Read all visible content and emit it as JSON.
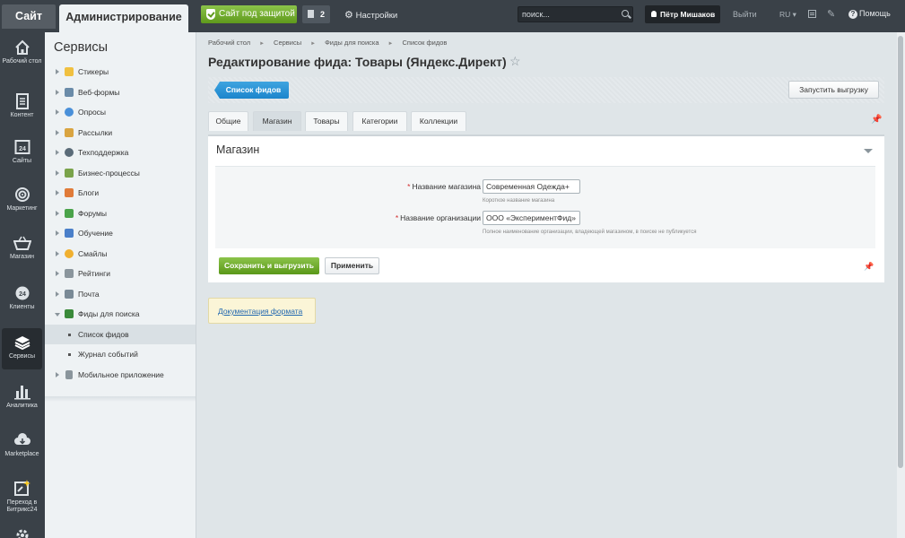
{
  "topbar": {
    "site_tab": "Сайт",
    "admin_tab": "Администрирование",
    "protect_button": "Сайт под защитой",
    "notifications_count": "2",
    "settings_label": "Настройки",
    "search_placeholder": "поиск...",
    "user_name": "Пётр Мишаков",
    "logout_label": "Выйти",
    "language": "RU",
    "help_label": "Помощь"
  },
  "leftnav": {
    "items": [
      {
        "label": "Рабочий стол",
        "icon": "home-icon"
      },
      {
        "label": "Контент",
        "icon": "document-icon"
      },
      {
        "label": "Сайты",
        "icon": "calendar-24-icon"
      },
      {
        "label": "Маркетинг",
        "icon": "target-icon"
      },
      {
        "label": "Магазин",
        "icon": "basket-icon"
      },
      {
        "label": "Клиенты",
        "icon": "clients-24-icon"
      },
      {
        "label": "Сервисы",
        "icon": "layers-icon"
      },
      {
        "label": "Аналитика",
        "icon": "bar-chart-icon"
      },
      {
        "label": "Marketplace",
        "icon": "cloud-download-icon"
      },
      {
        "label": "Переход в Битрикс24",
        "icon": "bitrix24-icon"
      }
    ]
  },
  "services": {
    "title": "Сервисы",
    "items": [
      {
        "label": "Стикеры",
        "color": "#f0c040"
      },
      {
        "label": "Веб-формы",
        "color": "#6a8ba8"
      },
      {
        "label": "Опросы",
        "color": "#4a90d9"
      },
      {
        "label": "Рассылки",
        "color": "#d9a441"
      },
      {
        "label": "Техподдержка",
        "color": "#5a6b78"
      },
      {
        "label": "Бизнес-процессы",
        "color": "#7aa34a"
      },
      {
        "label": "Блоги",
        "color": "#e07b39"
      },
      {
        "label": "Форумы",
        "color": "#4aa34a"
      },
      {
        "label": "Обучение",
        "color": "#4a7fc9"
      },
      {
        "label": "Смайлы",
        "color": "#f0b030"
      },
      {
        "label": "Рейтинги",
        "color": "#8a959c"
      },
      {
        "label": "Почта",
        "color": "#7a8a96"
      },
      {
        "label": "Фиды для поиска",
        "color": "#3a8a3a"
      },
      {
        "label": "Список фидов"
      },
      {
        "label": "Журнал событий"
      },
      {
        "label": "Мобильное приложение",
        "color": "#8a959c"
      }
    ]
  },
  "breadcrumb": [
    "Рабочий стол",
    "Сервисы",
    "Фиды для поиска",
    "Список фидов"
  ],
  "page_title": "Редактирование фида: Товары (Яндекс.Директ)",
  "toolbar": {
    "feeds_button": "Список фидов",
    "run_button": "Запустить выгрузку"
  },
  "tabs": [
    "Общие",
    "Магазин",
    "Товары",
    "Категории",
    "Коллекции"
  ],
  "panel": {
    "title": "Магазин",
    "fields": [
      {
        "label": "Название магазина",
        "value": "Современная Одежда+",
        "hint": "Короткое название магазина"
      },
      {
        "label": "Название организации",
        "value": "ООО «ЭкспериментФид»",
        "hint": "Полное наименование организации, владеющей магазином, в поиске не публикуется"
      }
    ],
    "save_button": "Сохранить и выгрузить",
    "apply_button": "Применить"
  },
  "doc_link": "Документация формата"
}
